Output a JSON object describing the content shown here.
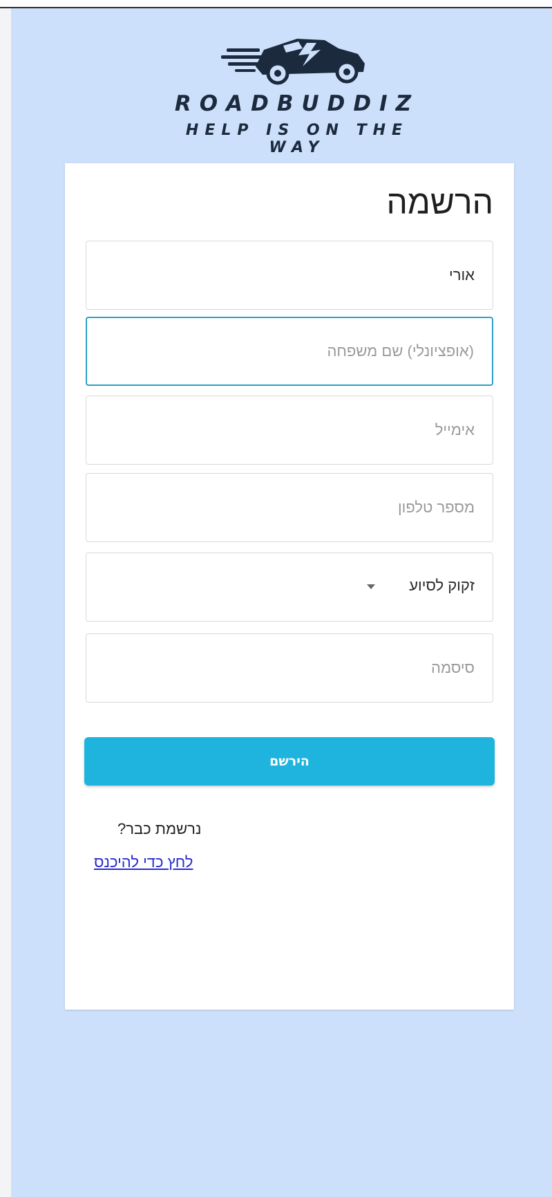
{
  "brand": {
    "name": "ROADBUDDIZ",
    "tagline": "HELP IS ON THE WAY"
  },
  "form": {
    "title": "הרשמה",
    "first_name": {
      "value": "אורי",
      "placeholder": ""
    },
    "last_name": {
      "value": "",
      "placeholder": "(אופציונלי) שם משפחה"
    },
    "email": {
      "value": "",
      "placeholder": "אימייל"
    },
    "phone": {
      "value": "",
      "placeholder": "מספר טלפון"
    },
    "role_select": {
      "selected": "זקוק לסיוע"
    },
    "password": {
      "value": "",
      "placeholder": "סיסמה"
    },
    "submit_label": "הירשם",
    "already_registered": "נרשמת כבר?",
    "login_link": "לחץ כדי להיכנס"
  },
  "colors": {
    "page_background": "#cde0fb",
    "accent": "#1fb4de",
    "focus_border": "#2aa0c8",
    "link": "#2a2ad0",
    "brand_dark": "#1b2a3d"
  },
  "icons": [
    "car-logo-icon",
    "chevron-down-icon"
  ]
}
